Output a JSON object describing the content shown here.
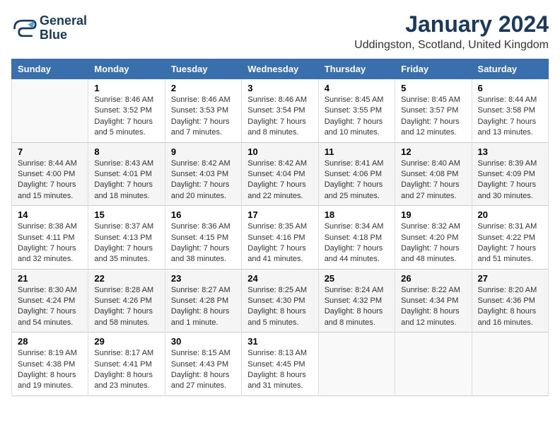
{
  "logo": {
    "name_line1": "General",
    "name_line2": "Blue"
  },
  "header": {
    "title": "January 2024",
    "subtitle": "Uddingston, Scotland, United Kingdom"
  },
  "days": [
    "Sunday",
    "Monday",
    "Tuesday",
    "Wednesday",
    "Thursday",
    "Friday",
    "Saturday"
  ],
  "weeks": [
    [
      {
        "date": "",
        "sunrise": "",
        "sunset": "",
        "daylight": ""
      },
      {
        "date": "1",
        "sunrise": "Sunrise: 8:46 AM",
        "sunset": "Sunset: 3:52 PM",
        "daylight": "Daylight: 7 hours and 5 minutes."
      },
      {
        "date": "2",
        "sunrise": "Sunrise: 8:46 AM",
        "sunset": "Sunset: 3:53 PM",
        "daylight": "Daylight: 7 hours and 7 minutes."
      },
      {
        "date": "3",
        "sunrise": "Sunrise: 8:46 AM",
        "sunset": "Sunset: 3:54 PM",
        "daylight": "Daylight: 7 hours and 8 minutes."
      },
      {
        "date": "4",
        "sunrise": "Sunrise: 8:45 AM",
        "sunset": "Sunset: 3:55 PM",
        "daylight": "Daylight: 7 hours and 10 minutes."
      },
      {
        "date": "5",
        "sunrise": "Sunrise: 8:45 AM",
        "sunset": "Sunset: 3:57 PM",
        "daylight": "Daylight: 7 hours and 12 minutes."
      },
      {
        "date": "6",
        "sunrise": "Sunrise: 8:44 AM",
        "sunset": "Sunset: 3:58 PM",
        "daylight": "Daylight: 7 hours and 13 minutes."
      }
    ],
    [
      {
        "date": "7",
        "sunrise": "Sunrise: 8:44 AM",
        "sunset": "Sunset: 4:00 PM",
        "daylight": "Daylight: 7 hours and 15 minutes."
      },
      {
        "date": "8",
        "sunrise": "Sunrise: 8:43 AM",
        "sunset": "Sunset: 4:01 PM",
        "daylight": "Daylight: 7 hours and 18 minutes."
      },
      {
        "date": "9",
        "sunrise": "Sunrise: 8:42 AM",
        "sunset": "Sunset: 4:03 PM",
        "daylight": "Daylight: 7 hours and 20 minutes."
      },
      {
        "date": "10",
        "sunrise": "Sunrise: 8:42 AM",
        "sunset": "Sunset: 4:04 PM",
        "daylight": "Daylight: 7 hours and 22 minutes."
      },
      {
        "date": "11",
        "sunrise": "Sunrise: 8:41 AM",
        "sunset": "Sunset: 4:06 PM",
        "daylight": "Daylight: 7 hours and 25 minutes."
      },
      {
        "date": "12",
        "sunrise": "Sunrise: 8:40 AM",
        "sunset": "Sunset: 4:08 PM",
        "daylight": "Daylight: 7 hours and 27 minutes."
      },
      {
        "date": "13",
        "sunrise": "Sunrise: 8:39 AM",
        "sunset": "Sunset: 4:09 PM",
        "daylight": "Daylight: 7 hours and 30 minutes."
      }
    ],
    [
      {
        "date": "14",
        "sunrise": "Sunrise: 8:38 AM",
        "sunset": "Sunset: 4:11 PM",
        "daylight": "Daylight: 7 hours and 32 minutes."
      },
      {
        "date": "15",
        "sunrise": "Sunrise: 8:37 AM",
        "sunset": "Sunset: 4:13 PM",
        "daylight": "Daylight: 7 hours and 35 minutes."
      },
      {
        "date": "16",
        "sunrise": "Sunrise: 8:36 AM",
        "sunset": "Sunset: 4:15 PM",
        "daylight": "Daylight: 7 hours and 38 minutes."
      },
      {
        "date": "17",
        "sunrise": "Sunrise: 8:35 AM",
        "sunset": "Sunset: 4:16 PM",
        "daylight": "Daylight: 7 hours and 41 minutes."
      },
      {
        "date": "18",
        "sunrise": "Sunrise: 8:34 AM",
        "sunset": "Sunset: 4:18 PM",
        "daylight": "Daylight: 7 hours and 44 minutes."
      },
      {
        "date": "19",
        "sunrise": "Sunrise: 8:32 AM",
        "sunset": "Sunset: 4:20 PM",
        "daylight": "Daylight: 7 hours and 48 minutes."
      },
      {
        "date": "20",
        "sunrise": "Sunrise: 8:31 AM",
        "sunset": "Sunset: 4:22 PM",
        "daylight": "Daylight: 7 hours and 51 minutes."
      }
    ],
    [
      {
        "date": "21",
        "sunrise": "Sunrise: 8:30 AM",
        "sunset": "Sunset: 4:24 PM",
        "daylight": "Daylight: 7 hours and 54 minutes."
      },
      {
        "date": "22",
        "sunrise": "Sunrise: 8:28 AM",
        "sunset": "Sunset: 4:26 PM",
        "daylight": "Daylight: 7 hours and 58 minutes."
      },
      {
        "date": "23",
        "sunrise": "Sunrise: 8:27 AM",
        "sunset": "Sunset: 4:28 PM",
        "daylight": "Daylight: 8 hours and 1 minute."
      },
      {
        "date": "24",
        "sunrise": "Sunrise: 8:25 AM",
        "sunset": "Sunset: 4:30 PM",
        "daylight": "Daylight: 8 hours and 5 minutes."
      },
      {
        "date": "25",
        "sunrise": "Sunrise: 8:24 AM",
        "sunset": "Sunset: 4:32 PM",
        "daylight": "Daylight: 8 hours and 8 minutes."
      },
      {
        "date": "26",
        "sunrise": "Sunrise: 8:22 AM",
        "sunset": "Sunset: 4:34 PM",
        "daylight": "Daylight: 8 hours and 12 minutes."
      },
      {
        "date": "27",
        "sunrise": "Sunrise: 8:20 AM",
        "sunset": "Sunset: 4:36 PM",
        "daylight": "Daylight: 8 hours and 16 minutes."
      }
    ],
    [
      {
        "date": "28",
        "sunrise": "Sunrise: 8:19 AM",
        "sunset": "Sunset: 4:38 PM",
        "daylight": "Daylight: 8 hours and 19 minutes."
      },
      {
        "date": "29",
        "sunrise": "Sunrise: 8:17 AM",
        "sunset": "Sunset: 4:41 PM",
        "daylight": "Daylight: 8 hours and 23 minutes."
      },
      {
        "date": "30",
        "sunrise": "Sunrise: 8:15 AM",
        "sunset": "Sunset: 4:43 PM",
        "daylight": "Daylight: 8 hours and 27 minutes."
      },
      {
        "date": "31",
        "sunrise": "Sunrise: 8:13 AM",
        "sunset": "Sunset: 4:45 PM",
        "daylight": "Daylight: 8 hours and 31 minutes."
      },
      {
        "date": "",
        "sunrise": "",
        "sunset": "",
        "daylight": ""
      },
      {
        "date": "",
        "sunrise": "",
        "sunset": "",
        "daylight": ""
      },
      {
        "date": "",
        "sunrise": "",
        "sunset": "",
        "daylight": ""
      }
    ]
  ]
}
